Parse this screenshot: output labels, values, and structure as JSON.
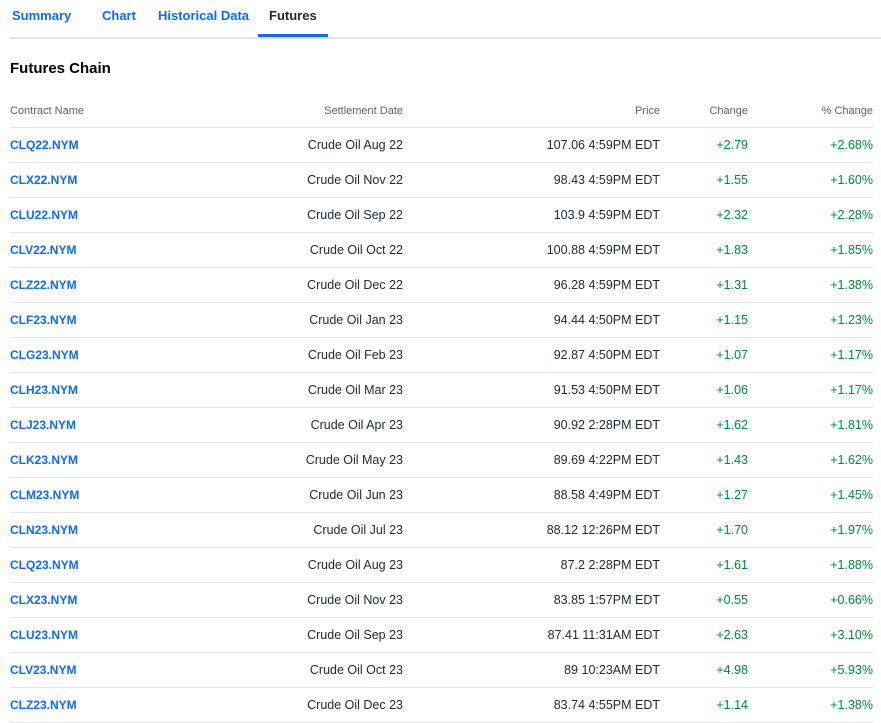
{
  "tabs": [
    {
      "label": "Summary"
    },
    {
      "label": "Chart"
    },
    {
      "label": "Historical Data"
    },
    {
      "label": "Futures"
    }
  ],
  "active_tab": "Futures",
  "section_title": "Futures Chain",
  "table": {
    "headers": {
      "contract_name": "Contract Name",
      "settlement_date": "Settlement Date",
      "price": "Price",
      "change": "Change",
      "pct_change": "% Change"
    },
    "rows": [
      {
        "contract": "CLQ22.NYM",
        "settlement": "Crude Oil Aug 22",
        "price": "107.06 4:59PM EDT",
        "change": "+2.79",
        "pct": "+2.68%"
      },
      {
        "contract": "CLX22.NYM",
        "settlement": "Crude Oil Nov 22",
        "price": "98.43 4:59PM EDT",
        "change": "+1.55",
        "pct": "+1.60%"
      },
      {
        "contract": "CLU22.NYM",
        "settlement": "Crude Oil Sep 22",
        "price": "103.9 4:59PM EDT",
        "change": "+2.32",
        "pct": "+2.28%"
      },
      {
        "contract": "CLV22.NYM",
        "settlement": "Crude Oil Oct 22",
        "price": "100.88 4:59PM EDT",
        "change": "+1.83",
        "pct": "+1.85%"
      },
      {
        "contract": "CLZ22.NYM",
        "settlement": "Crude Oil Dec 22",
        "price": "96.28 4:59PM EDT",
        "change": "+1.31",
        "pct": "+1.38%"
      },
      {
        "contract": "CLF23.NYM",
        "settlement": "Crude Oil Jan 23",
        "price": "94.44 4:50PM EDT",
        "change": "+1.15",
        "pct": "+1.23%"
      },
      {
        "contract": "CLG23.NYM",
        "settlement": "Crude Oil Feb 23",
        "price": "92.87 4:50PM EDT",
        "change": "+1.07",
        "pct": "+1.17%"
      },
      {
        "contract": "CLH23.NYM",
        "settlement": "Crude Oil Mar 23",
        "price": "91.53 4:50PM EDT",
        "change": "+1.06",
        "pct": "+1.17%"
      },
      {
        "contract": "CLJ23.NYM",
        "settlement": "Crude Oil Apr 23",
        "price": "90.92 2:28PM EDT",
        "change": "+1.62",
        "pct": "+1.81%"
      },
      {
        "contract": "CLK23.NYM",
        "settlement": "Crude Oil May 23",
        "price": "89.69 4:22PM EDT",
        "change": "+1.43",
        "pct": "+1.62%"
      },
      {
        "contract": "CLM23.NYM",
        "settlement": "Crude Oil Jun 23",
        "price": "88.58 4:49PM EDT",
        "change": "+1.27",
        "pct": "+1.45%"
      },
      {
        "contract": "CLN23.NYM",
        "settlement": "Crude Oil Jul 23",
        "price": "88.12 12:26PM EDT",
        "change": "+1.70",
        "pct": "+1.97%"
      },
      {
        "contract": "CLQ23.NYM",
        "settlement": "Crude Oil Aug 23",
        "price": "87.2 2:28PM EDT",
        "change": "+1.61",
        "pct": "+1.88%"
      },
      {
        "contract": "CLX23.NYM",
        "settlement": "Crude Oil Nov 23",
        "price": "83.85 1:57PM EDT",
        "change": "+0.55",
        "pct": "+0.66%"
      },
      {
        "contract": "CLU23.NYM",
        "settlement": "Crude Oil Sep 23",
        "price": "87.41 11:31AM EDT",
        "change": "+2.63",
        "pct": "+3.10%"
      },
      {
        "contract": "CLV23.NYM",
        "settlement": "Crude Oil Oct 23",
        "price": "89 10:23AM EDT",
        "change": "+4.98",
        "pct": "+5.93%"
      },
      {
        "contract": "CLZ23.NYM",
        "settlement": "Crude Oil Dec 23",
        "price": "83.74 4:55PM EDT",
        "change": "+1.14",
        "pct": "+1.38%"
      }
    ]
  },
  "colors": {
    "link": "#0f69ff",
    "positive": "#008a3a",
    "text": "#232a31",
    "muted": "#5b636a",
    "divider": "#e0e4e9"
  }
}
